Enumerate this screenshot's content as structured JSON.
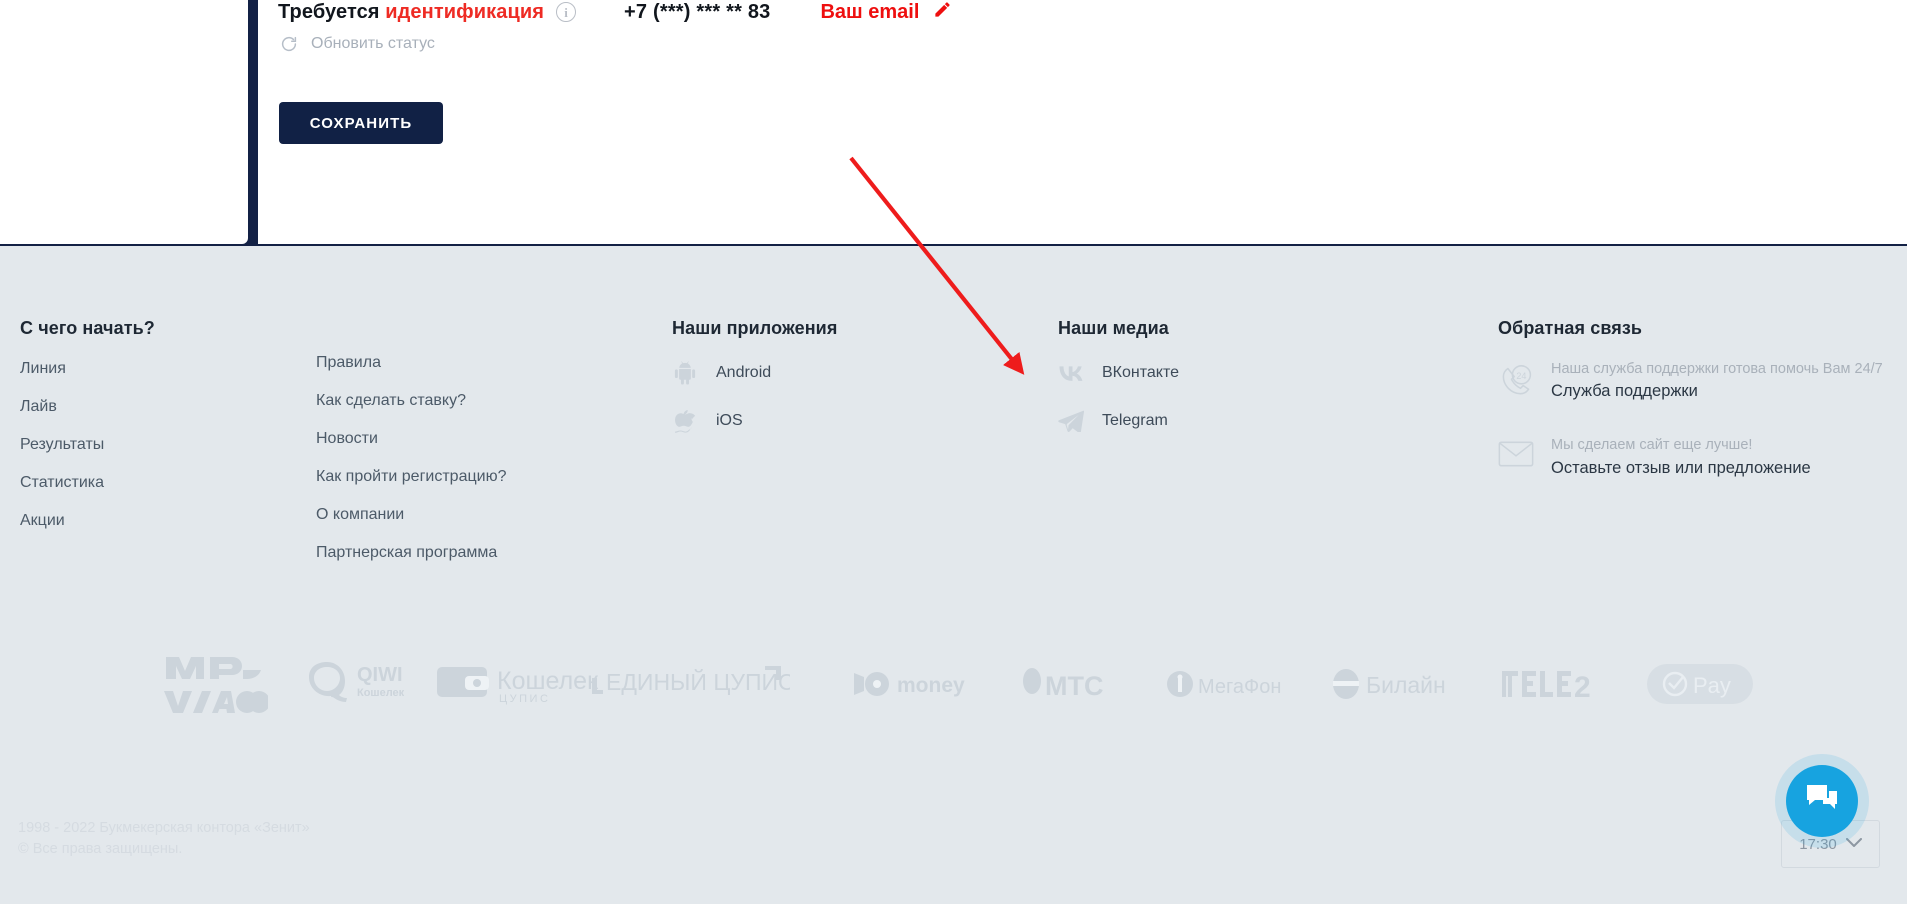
{
  "account": {
    "identification_prefix": "Требуется ",
    "identification_word": "идентификация",
    "info_icon_char": "i",
    "phone": "+7 (***) *** ** 83",
    "email_link": "Ваш email",
    "refresh_label": "Обновить статус",
    "save_label": "СОХРАНИТЬ"
  },
  "footer": {
    "columns": [
      {
        "title": "С чего начать?",
        "links": [
          "Линия",
          "Лайв",
          "Результаты",
          "Статистика",
          "Акции"
        ]
      },
      {
        "title": "",
        "links": [
          "Правила",
          "Как сделать ставку?",
          "Новости",
          "Как пройти регистрацию?",
          "О компании",
          "Партнерская программа"
        ]
      }
    ],
    "apps": {
      "title": "Наши приложения",
      "items": [
        {
          "label": "Android",
          "icon": "android-icon"
        },
        {
          "label": "iOS",
          "icon": "apple-icon"
        }
      ]
    },
    "media": {
      "title": "Наши медиа",
      "items": [
        {
          "label": "ВКонтакте",
          "icon": "vk-icon"
        },
        {
          "label": "Telegram",
          "icon": "telegram-icon"
        }
      ]
    },
    "feedback": {
      "title": "Обратная связь",
      "items": [
        {
          "sub": "Наша служба поддержки готова помочь Вам 24/7",
          "main": "Служба поддержки",
          "icon": "phone-24-icon"
        },
        {
          "sub": "Мы сделаем сайт еще лучше!",
          "main": "Оставьте отзыв или предложение",
          "icon": "envelope-icon"
        }
      ]
    },
    "payments": [
      {
        "name": "mir-visa-mastercard-logo",
        "label": "МИР VISA"
      },
      {
        "name": "qiwi-logo",
        "label": "QIWI Кошелек"
      },
      {
        "name": "koshelek-cupis-logo",
        "label": "Кошелек ЦУПИС"
      },
      {
        "name": "edinyy-cupis-logo",
        "label": "ЕДИНЫЙ ЦУПИС"
      },
      {
        "name": "yoomoney-logo",
        "label": "money"
      },
      {
        "name": "mts-logo",
        "label": "МТС"
      },
      {
        "name": "megafon-logo",
        "label": "МегаФон"
      },
      {
        "name": "beeline-logo",
        "label": "Билайн"
      },
      {
        "name": "tele2-logo",
        "label": "TELE2"
      },
      {
        "name": "pay-logo",
        "label": "Pay"
      }
    ],
    "copyright_line1": "1998 - 2022 Букмекерская контора «Зенит»",
    "copyright_line2": "© Все права защищены."
  },
  "chat": {
    "time": "17:30",
    "icon": "chat-bubble-icon",
    "chevron": "chevron-down-icon"
  },
  "colors": {
    "accent_red": "#ee2b24",
    "email_red": "#ee0f0f",
    "navy": "#112145",
    "footer_bg": "#e3e8ec",
    "chat_blue": "#17a3e0",
    "arrow_red": "#ee1c1c"
  }
}
